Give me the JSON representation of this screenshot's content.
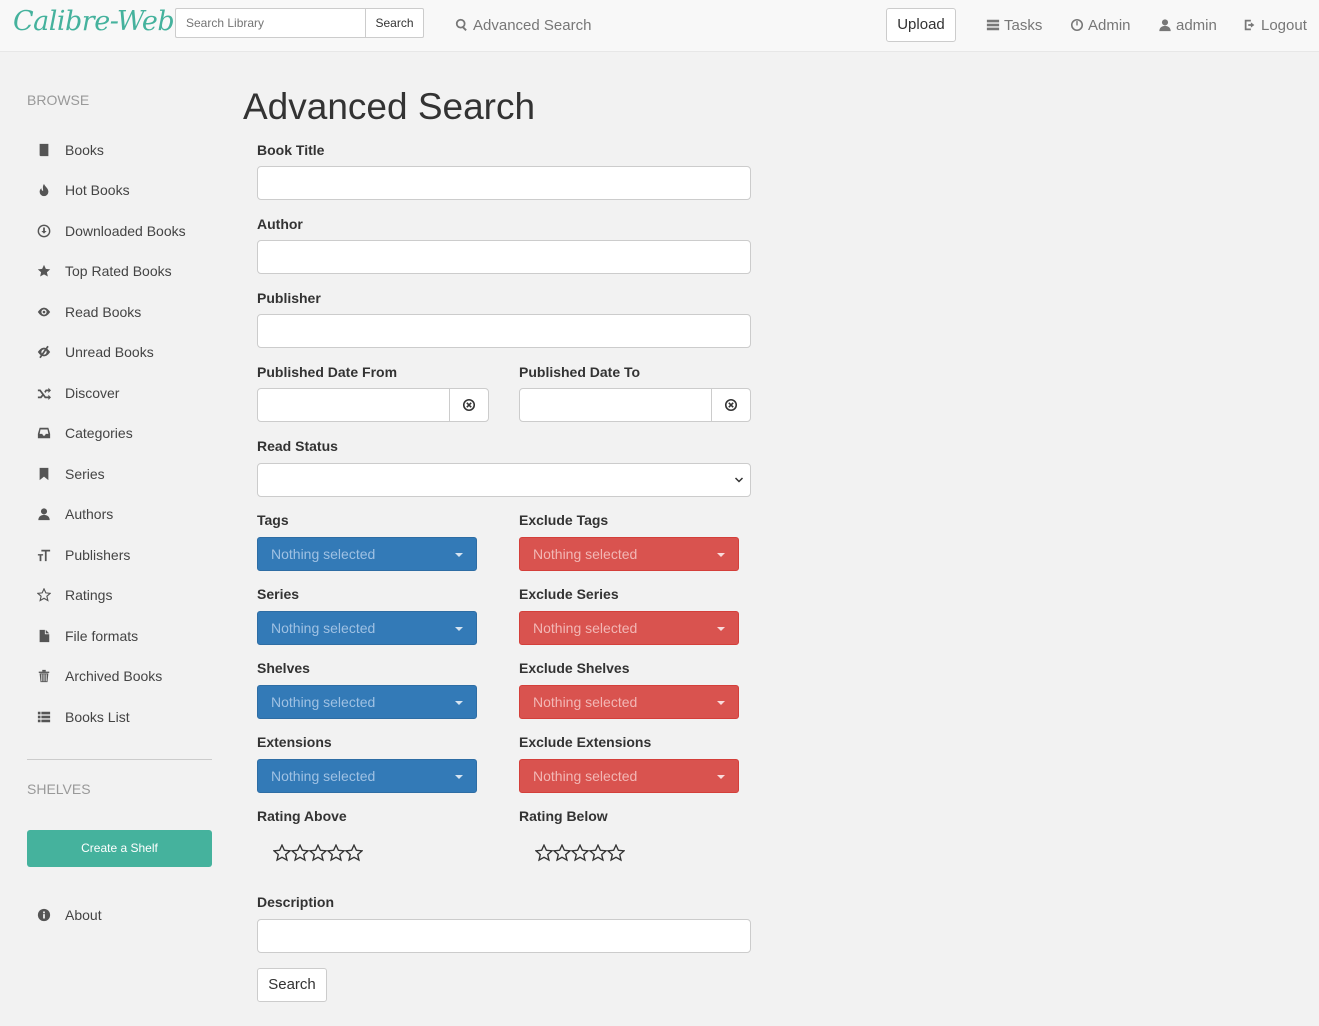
{
  "header": {
    "brand": "Calibre-Web",
    "search_placeholder": "Search Library",
    "search_button": "Search",
    "advanced_search": "Advanced Search",
    "upload": "Upload",
    "tasks": "Tasks",
    "admin_link": "Admin",
    "user": "admin",
    "logout": "Logout"
  },
  "sidebar": {
    "browse_header": "BROWSE",
    "items": [
      {
        "label": "Books",
        "icon": "book-icon"
      },
      {
        "label": "Hot Books",
        "icon": "fire-icon"
      },
      {
        "label": "Downloaded Books",
        "icon": "download-icon"
      },
      {
        "label": "Top Rated Books",
        "icon": "star-icon"
      },
      {
        "label": "Read Books",
        "icon": "eye-icon"
      },
      {
        "label": "Unread Books",
        "icon": "eye-slash-icon"
      },
      {
        "label": "Discover",
        "icon": "shuffle-icon"
      },
      {
        "label": "Categories",
        "icon": "inbox-icon"
      },
      {
        "label": "Series",
        "icon": "bookmark-icon"
      },
      {
        "label": "Authors",
        "icon": "user-icon"
      },
      {
        "label": "Publishers",
        "icon": "text-size-icon"
      },
      {
        "label": "Ratings",
        "icon": "star-empty-icon"
      },
      {
        "label": "File formats",
        "icon": "file-icon"
      },
      {
        "label": "Archived Books",
        "icon": "trash-icon"
      },
      {
        "label": "Books List",
        "icon": "list-icon"
      }
    ],
    "shelves_header": "SHELVES",
    "create_shelf": "Create a Shelf",
    "about": "About"
  },
  "form": {
    "title": "Advanced Search",
    "book_title_label": "Book Title",
    "author_label": "Author",
    "publisher_label": "Publisher",
    "date_from_label": "Published Date From",
    "date_to_label": "Published Date To",
    "read_status_label": "Read Status",
    "tags_label": "Tags",
    "exclude_tags_label": "Exclude Tags",
    "series_label": "Series",
    "exclude_series_label": "Exclude Series",
    "shelves_label": "Shelves",
    "exclude_shelves_label": "Exclude Shelves",
    "extensions_label": "Extensions",
    "exclude_extensions_label": "Exclude Extensions",
    "rating_above_label": "Rating Above",
    "rating_below_label": "Rating Below",
    "description_label": "Description",
    "nothing_selected": "Nothing selected",
    "search_button": "Search",
    "rating_above_value": 0,
    "rating_below_value": 0,
    "colors": {
      "include": "#337ab7",
      "exclude": "#d9534f",
      "accent": "#45b29d"
    }
  }
}
